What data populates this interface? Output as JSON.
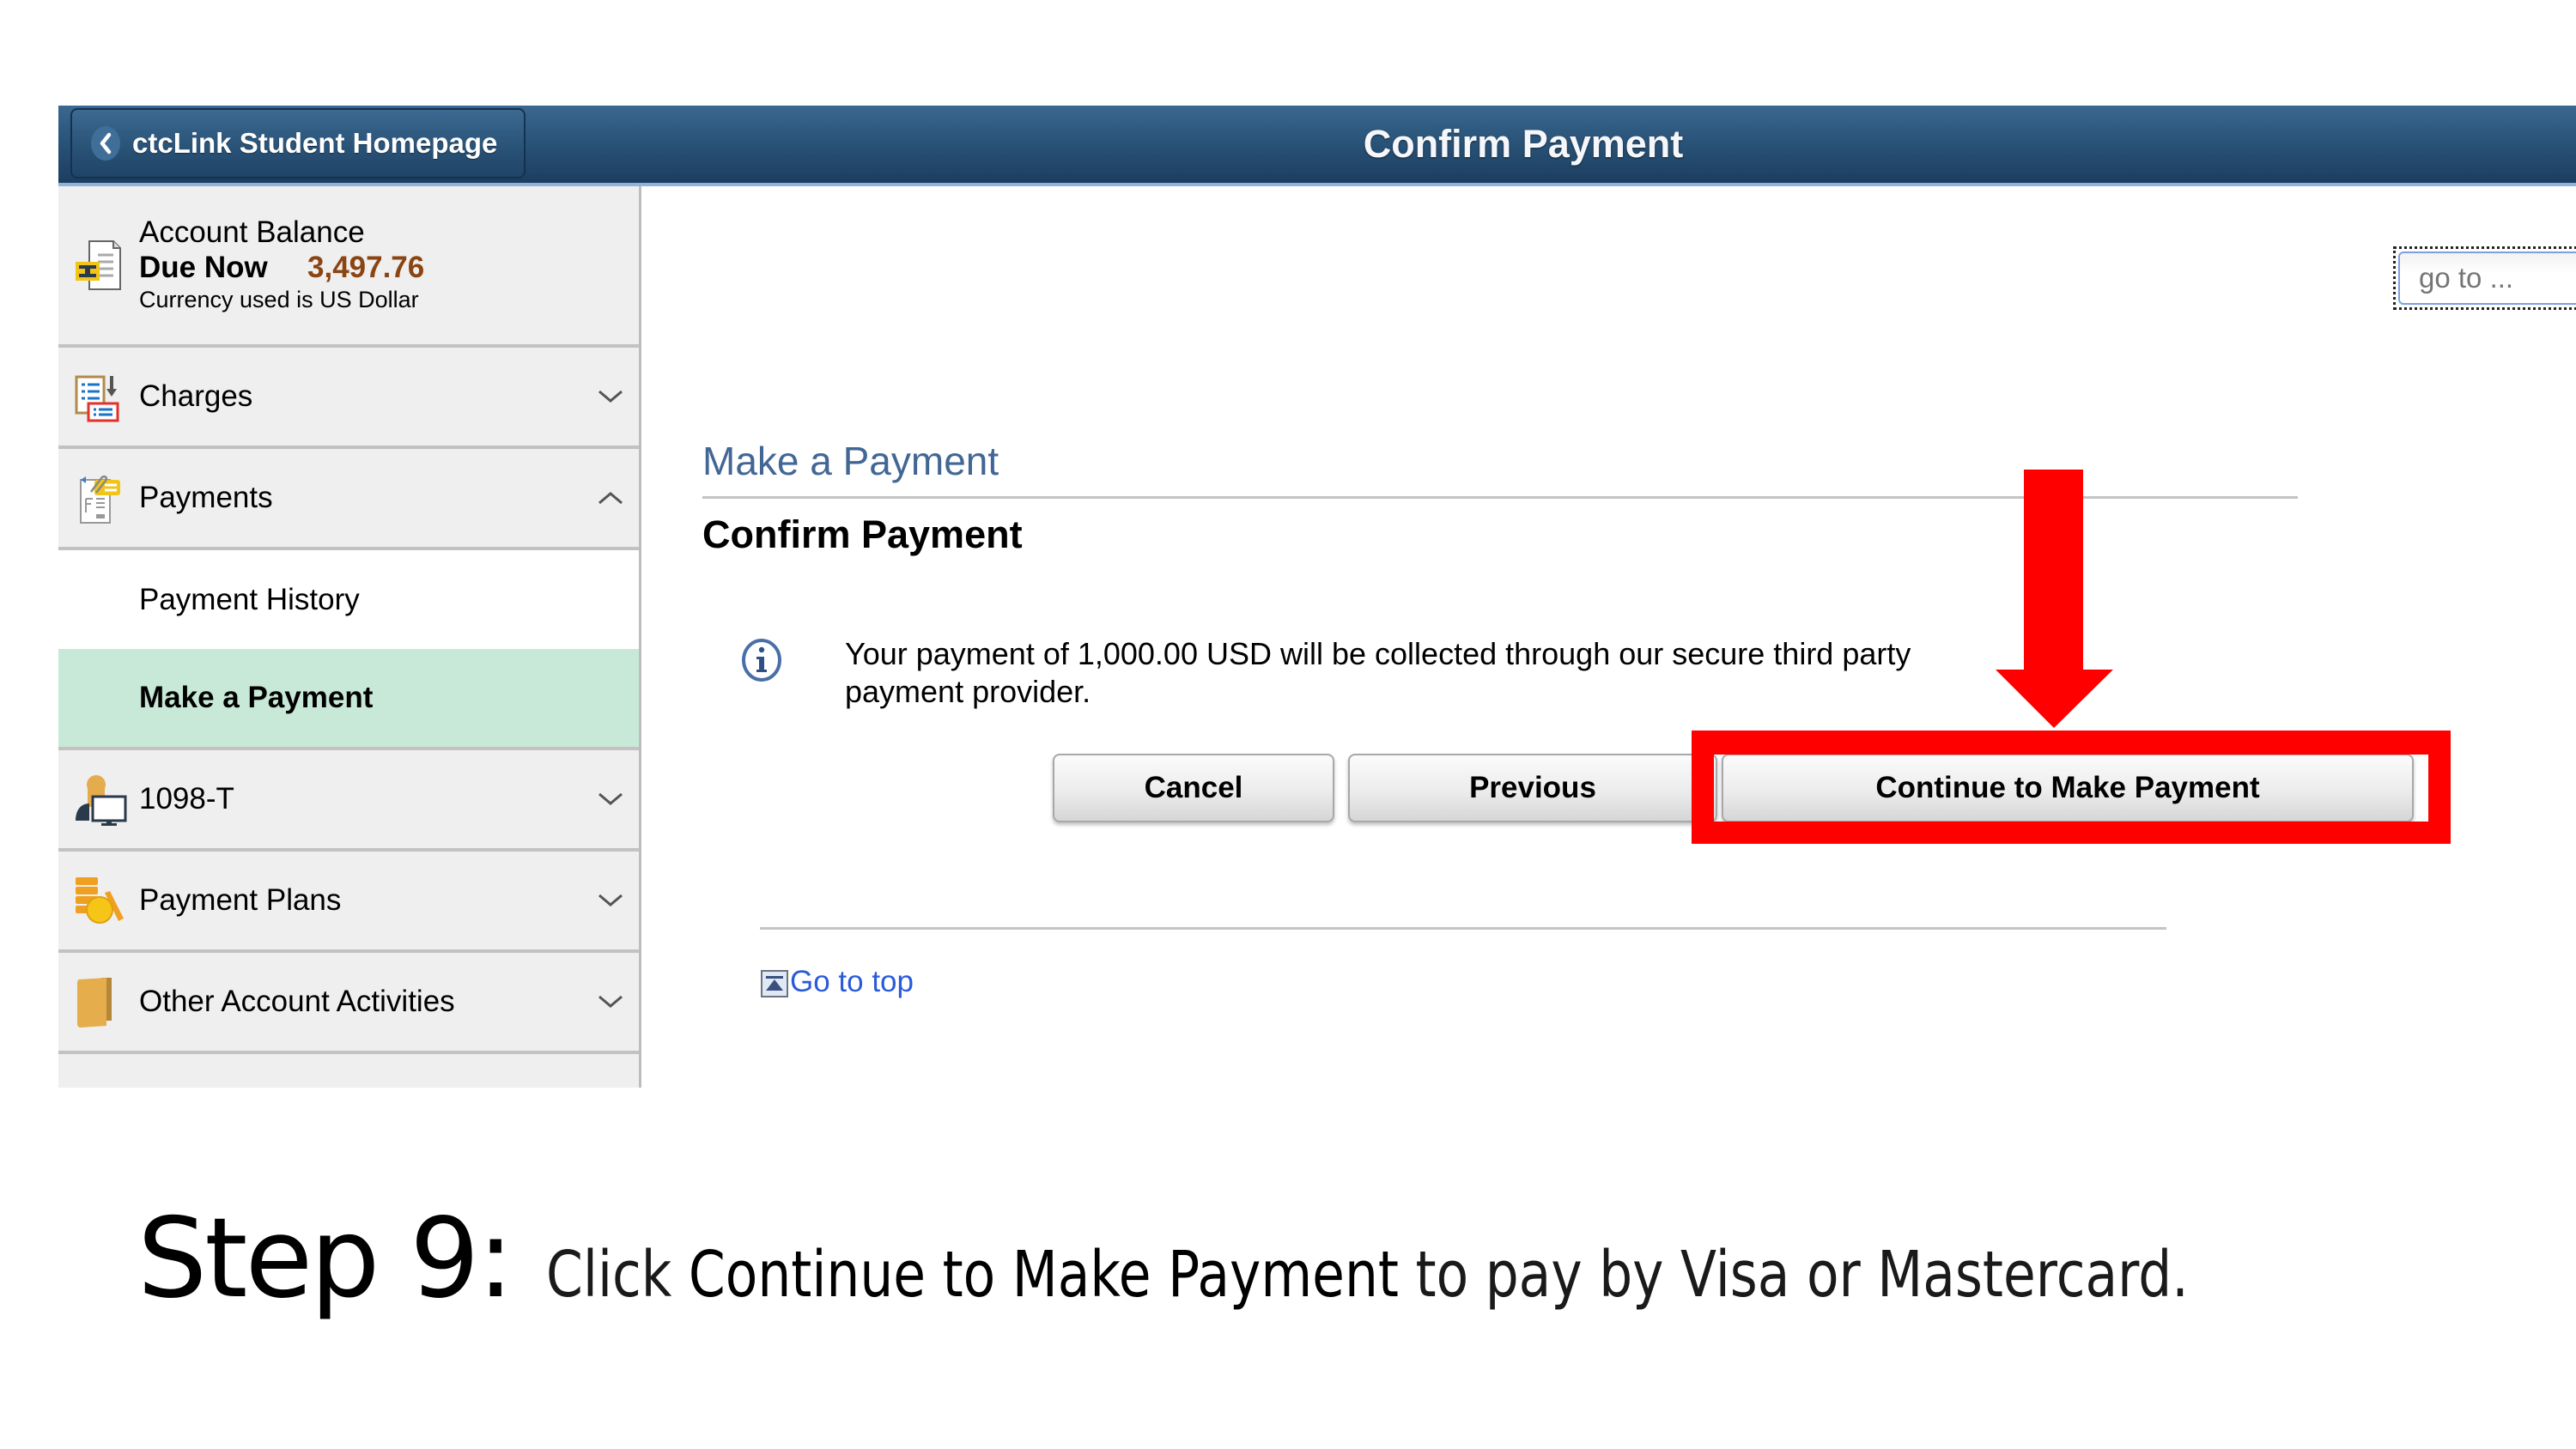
{
  "header": {
    "back_label": "ctcLink Student Homepage",
    "page_title": "Confirm Payment",
    "back_icon": "chevron-left-icon"
  },
  "sidebar": {
    "account": {
      "title": "Account Balance",
      "due_label": "Due Now",
      "due_amount": "3,497.76",
      "currency_note": "Currency used is US Dollar",
      "icon": "account-balance-icon",
      "amount_color": "#8b4513"
    },
    "items": [
      {
        "label": "Charges",
        "icon": "charges-icon",
        "expanded": false
      },
      {
        "label": "Payments",
        "icon": "payments-icon",
        "expanded": true,
        "children": [
          {
            "label": "Payment History",
            "active": false
          },
          {
            "label": "Make a Payment",
            "active": true
          }
        ]
      },
      {
        "label": "1098-T",
        "icon": "tax-form-icon",
        "expanded": false
      },
      {
        "label": "Payment Plans",
        "icon": "payment-plans-icon",
        "expanded": false
      },
      {
        "label": "Other Account Activities",
        "icon": "folder-icon",
        "expanded": false
      }
    ],
    "active_color": "#c8e9d8"
  },
  "main": {
    "goto_placeholder": "go to ...",
    "section_title": "Make a Payment",
    "sub_title": "Confirm Payment",
    "info_message": "Your payment of 1,000.00 USD will be collected through our secure third party payment provider.",
    "buttons": {
      "cancel": "Cancel",
      "previous": "Previous",
      "continue": "Continue to Make Payment"
    },
    "go_to_top": "Go to top"
  },
  "annotation": {
    "highlight_color": "#ff0000",
    "highlight_target": "Continue to Make Payment",
    "arrow_direction": "down"
  },
  "caption": {
    "step": "Step 9:",
    "prefix": "Click ",
    "emphasis": "Continue to Make Payment",
    "suffix": " to pay by Visa or Mastercard."
  }
}
